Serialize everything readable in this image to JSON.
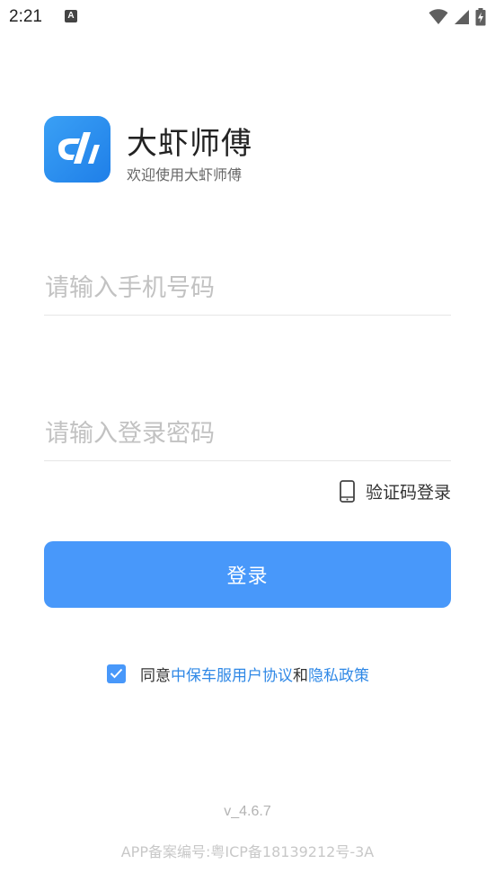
{
  "status_bar": {
    "time": "2:21",
    "notification_icon": "a-icon",
    "icons": [
      "wifi-icon",
      "signal-icon",
      "battery-charging-icon"
    ]
  },
  "brand": {
    "app_name": "大虾师傅",
    "subtitle": "欢迎使用大虾师傅",
    "logo_icon": "dx-logo",
    "logo_color": "#2a8cf0"
  },
  "form": {
    "phone_placeholder": "请输入手机号码",
    "phone_value": "",
    "password_placeholder": "请输入登录密码",
    "password_value": "",
    "sms_login_label": "验证码登录",
    "sms_login_icon": "phone-icon",
    "login_button_label": "登录"
  },
  "agreement": {
    "checked": true,
    "prefix": "同意",
    "user_agreement_link": "中保车服用户协议",
    "conjunction": "和",
    "privacy_link": "隐私政策"
  },
  "footer": {
    "version": "v_4.6.7",
    "icp": "APP备案编号:粤ICP备18139212号-3A"
  },
  "colors": {
    "accent": "#4898fa",
    "link": "#2f88e6",
    "placeholder": "#c2c2c2",
    "divider": "#e6e6e6"
  }
}
